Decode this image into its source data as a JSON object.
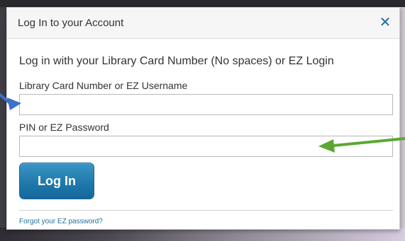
{
  "modal": {
    "title": "Log In to your Account",
    "close_glyph": "✕",
    "intro": "Log in with your Library Card Number (No spaces) or EZ Login",
    "card_label": "Library Card Number or EZ Username",
    "card_value": "",
    "pin_label": "PIN or EZ Password",
    "pin_value": "",
    "login_label": "Log In",
    "forgot_link": "Forgot your EZ password?"
  },
  "annotations": {
    "blue_arrow_color": "#3e6fc9",
    "green_arrow_color": "#5aa832"
  },
  "colors": {
    "accent": "#1f79ad",
    "link": "#1f6e99"
  }
}
